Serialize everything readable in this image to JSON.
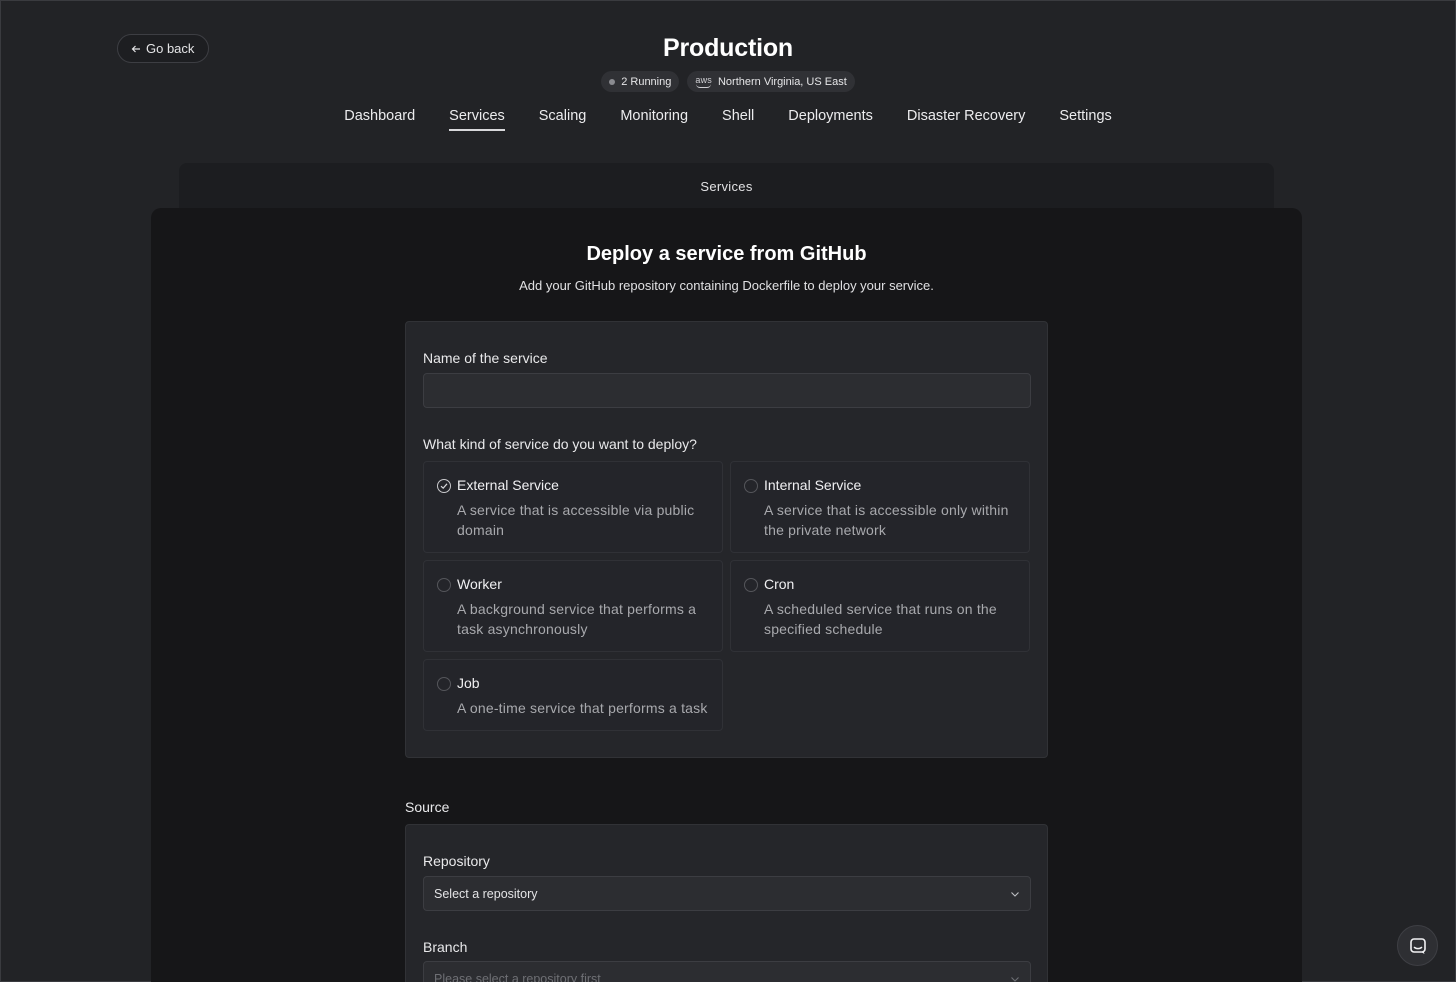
{
  "header": {
    "back_label": "Go back",
    "title": "Production",
    "status_badge": "2 Running",
    "region_badge": "Northern Virginia, US East",
    "provider_logo": "aws"
  },
  "tabs": [
    {
      "label": "Dashboard",
      "active": false
    },
    {
      "label": "Services",
      "active": true
    },
    {
      "label": "Scaling",
      "active": false
    },
    {
      "label": "Monitoring",
      "active": false
    },
    {
      "label": "Shell",
      "active": false
    },
    {
      "label": "Deployments",
      "active": false
    },
    {
      "label": "Disaster Recovery",
      "active": false
    },
    {
      "label": "Settings",
      "active": false
    }
  ],
  "section_bar": "Services",
  "form": {
    "heading": "Deploy a service from GitHub",
    "subheading": "Add your GitHub repository containing Dockerfile to deploy your service.",
    "name_label": "Name of the service",
    "name_value": "",
    "kind_label": "What kind of service do you want to deploy?",
    "options": [
      {
        "title": "External Service",
        "desc": "A service that is accessible via public domain",
        "selected": true
      },
      {
        "title": "Internal Service",
        "desc": "A service that is accessible only within the private network",
        "selected": false
      },
      {
        "title": "Worker",
        "desc": "A background service that performs a task asynchronously",
        "selected": false
      },
      {
        "title": "Cron",
        "desc": "A scheduled service that runs on the specified schedule",
        "selected": false
      },
      {
        "title": "Job",
        "desc": "A one-time service that performs a task",
        "selected": false
      }
    ],
    "source_label": "Source",
    "repository_label": "Repository",
    "repository_placeholder": "Select a repository",
    "branch_label": "Branch",
    "branch_placeholder": "Please select a repository first"
  },
  "icons": {
    "back": "arrow-left-icon",
    "chat": "chat-icon",
    "dropdown": "chevron-down-icon",
    "selected": "check-icon"
  }
}
